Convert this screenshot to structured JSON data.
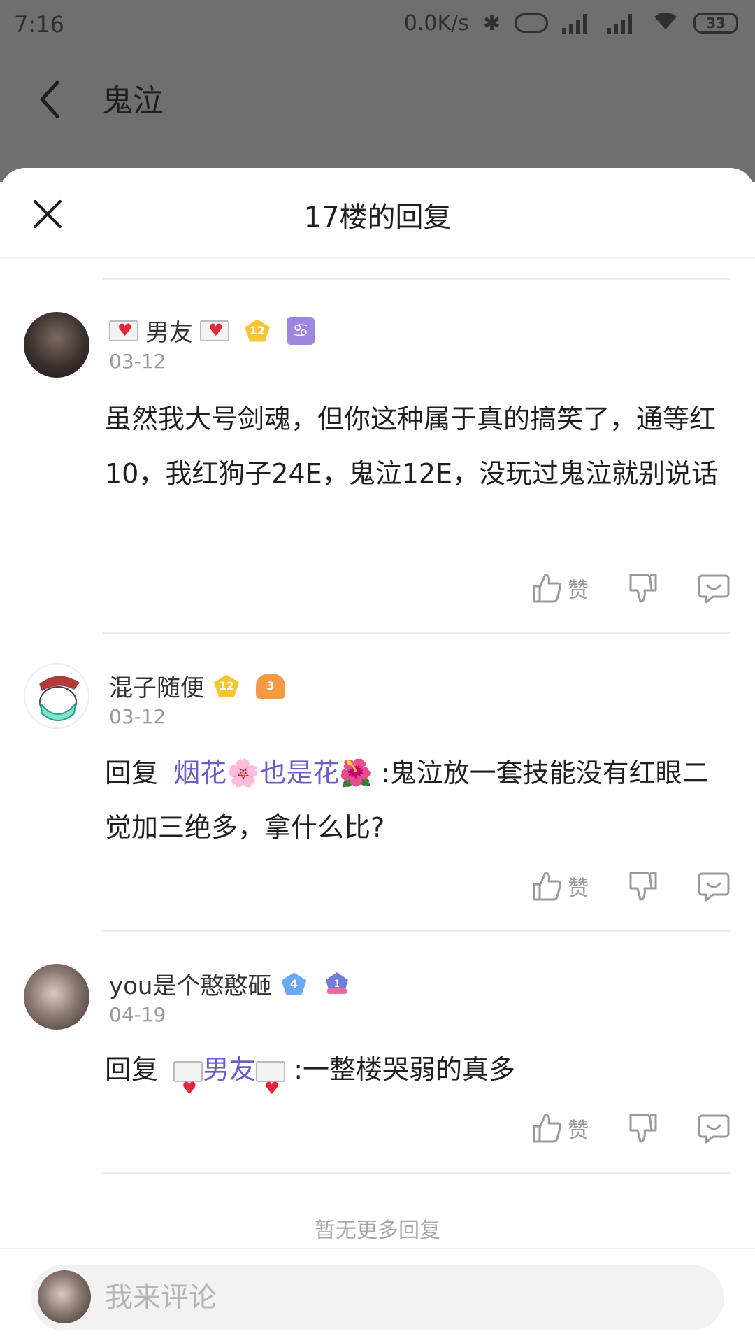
{
  "status_bar": {
    "time": "7:16",
    "network_speed": "0.0K/s",
    "battery": "33"
  },
  "app_header": {
    "title": "鬼泣"
  },
  "sheet": {
    "title": "17楼的回复"
  },
  "replies": [
    {
      "username": "男友",
      "level": "12",
      "extra_badge": "♋",
      "date": "03-12",
      "content": "虽然我大号剑魂，但你这种属于真的搞笑了，通等红10，我红狗子24E，鬼泣12E，没玩过鬼泣就别说话",
      "like_label": "赞"
    },
    {
      "username": "混子随便",
      "level": "12",
      "extra_badge": "3",
      "date": "03-12",
      "reply_prefix": "回复",
      "mention": "烟花🌸也是花🌺",
      "content": " :鬼泣放一套技能没有红眼二觉加三绝多，拿什么比?",
      "like_label": "赞"
    },
    {
      "username": "you是个憨憨砸",
      "level": "4",
      "extra_badge": "1",
      "date": "04-19",
      "reply_prefix": "回复",
      "mention": "男友",
      "content": " :一整楼哭弱的真多",
      "like_label": "赞"
    }
  ],
  "footer_note": "暂无更多回复",
  "comment_bar": {
    "placeholder": "我来评论"
  }
}
